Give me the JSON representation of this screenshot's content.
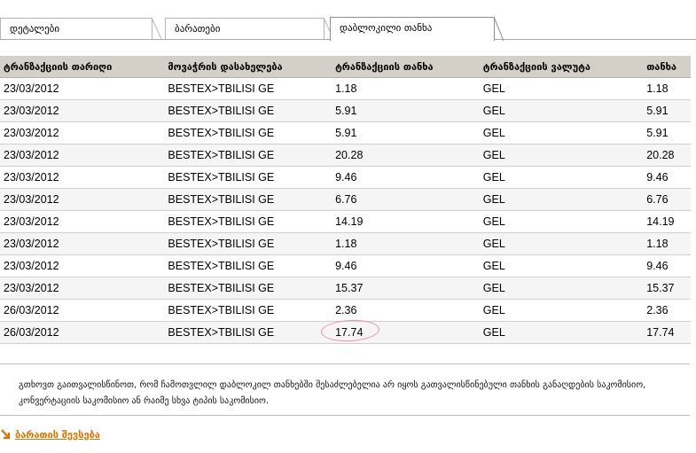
{
  "tabs": [
    {
      "label": "დეტალები",
      "active": false
    },
    {
      "label": "ბარათები",
      "active": false
    },
    {
      "label": "დაბლოკილი თანხა",
      "active": true
    }
  ],
  "table": {
    "headers": [
      "ტრანზაქციის თარიღი",
      "მოვაჭრის დასახელება",
      "ტრანზაქციის თანხა",
      "ტრანზაქციის ვალუტა",
      "თანხა"
    ],
    "rows": [
      [
        "23/03/2012",
        "BESTEX>TBILISI GE",
        "1.18",
        "GEL",
        "1.18"
      ],
      [
        "23/03/2012",
        "BESTEX>TBILISI GE",
        "5.91",
        "GEL",
        "5.91"
      ],
      [
        "23/03/2012",
        "BESTEX>TBILISI GE",
        "5.91",
        "GEL",
        "5.91"
      ],
      [
        "23/03/2012",
        "BESTEX>TBILISI GE",
        "20.28",
        "GEL",
        "20.28"
      ],
      [
        "23/03/2012",
        "BESTEX>TBILISI GE",
        "9.46",
        "GEL",
        "9.46"
      ],
      [
        "23/03/2012",
        "BESTEX>TBILISI GE",
        "6.76",
        "GEL",
        "6.76"
      ],
      [
        "23/03/2012",
        "BESTEX>TBILISI GE",
        "14.19",
        "GEL",
        "14.19"
      ],
      [
        "23/03/2012",
        "BESTEX>TBILISI GE",
        "1.18",
        "GEL",
        "1.18"
      ],
      [
        "23/03/2012",
        "BESTEX>TBILISI GE",
        "9.46",
        "GEL",
        "9.46"
      ],
      [
        "23/03/2012",
        "BESTEX>TBILISI GE",
        "15.37",
        "GEL",
        "15.37"
      ],
      [
        "26/03/2012",
        "BESTEX>TBILISI GE",
        "2.36",
        "GEL",
        "2.36"
      ],
      [
        "26/03/2012",
        "BESTEX>TBILISI GE",
        "17.74",
        "GEL",
        "17.74"
      ]
    ]
  },
  "note": "გთხოვთ გაითვალისწინოთ, რომ ჩამოთვლილ დაბლოკილ თანხებში შესაძლებელია არ იყოს გათვალისწინებული თანხის განაღდების საკომისიო, კონვერტაციის საკომისიო ან რაიმე სხვა ტიპის საკომისიო.",
  "back_link": {
    "label": "ბარათის შევსება",
    "icon": "orange-arrow-icon"
  },
  "colors": {
    "header_bg": "#d4d0c8",
    "link": "#e07000",
    "highlight_circle": "#ef8fb3"
  }
}
